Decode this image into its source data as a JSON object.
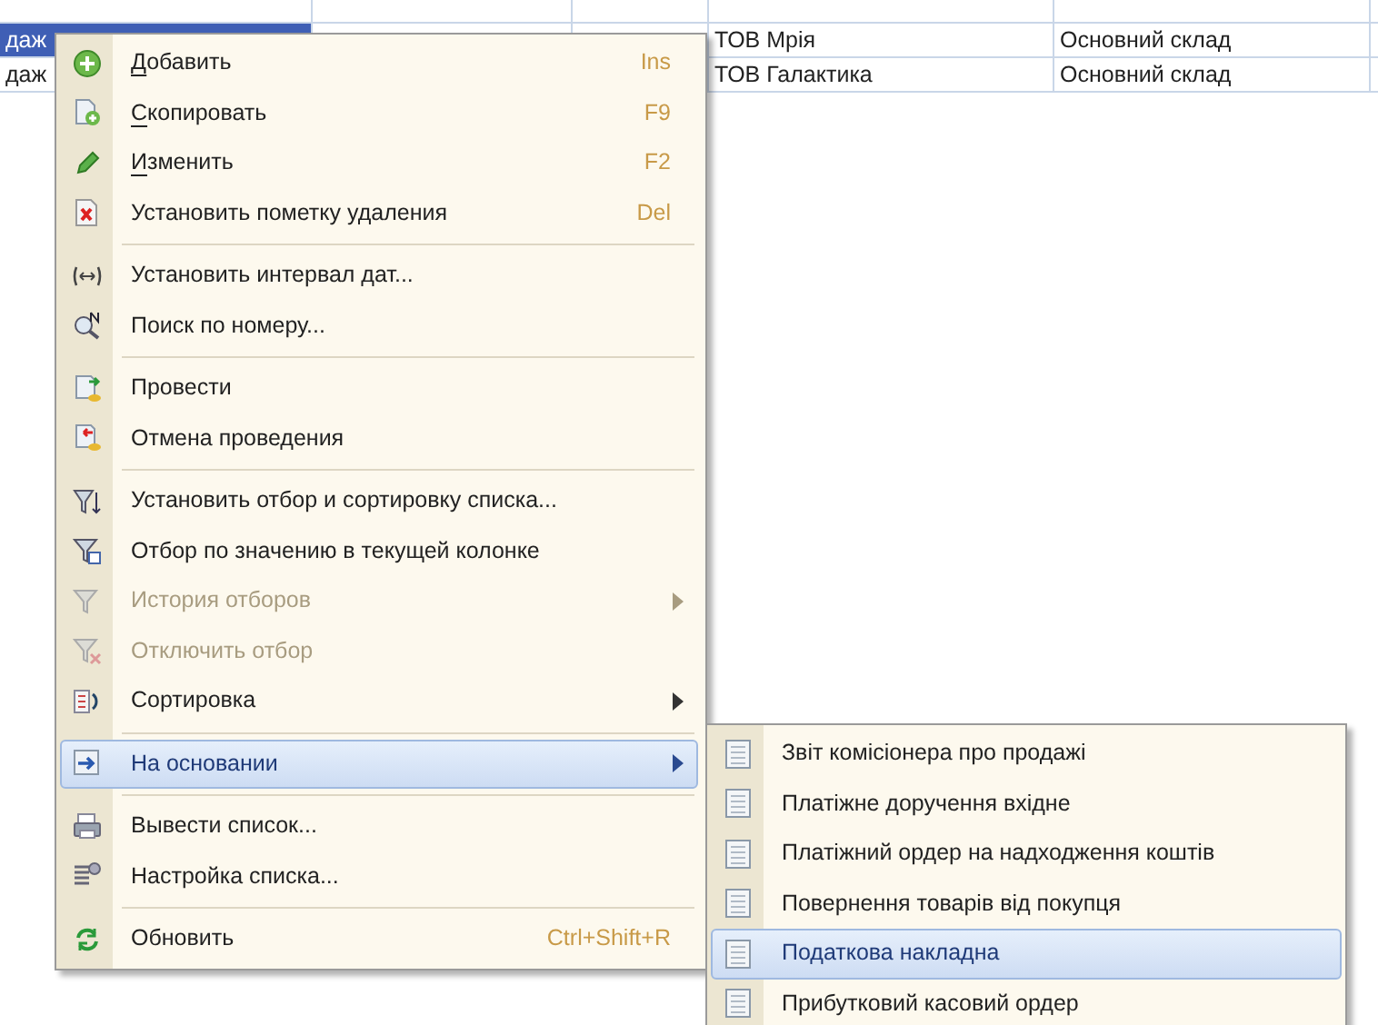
{
  "table": {
    "rows": [
      {
        "selected": true,
        "cells": [
          "даж",
          "ТОВ Мрія",
          "Основний склад"
        ]
      },
      {
        "selected": false,
        "cells": [
          "даж",
          "ТОВ Галактика",
          "Основний склад"
        ]
      }
    ]
  },
  "context_menu": {
    "items": [
      {
        "kind": "item",
        "label": "Добавить",
        "underline_first": true,
        "shortcut": "Ins",
        "disabled": false,
        "submenu": false,
        "selected": false
      },
      {
        "kind": "item",
        "label": "Скопировать",
        "underline_first": true,
        "shortcut": "F9",
        "disabled": false,
        "submenu": false,
        "selected": false
      },
      {
        "kind": "item",
        "label": "Изменить",
        "underline_first": true,
        "shortcut": "F2",
        "disabled": false,
        "submenu": false,
        "selected": false
      },
      {
        "kind": "item",
        "label": "Установить пометку удаления",
        "underline_first": false,
        "shortcut": "Del",
        "disabled": false,
        "submenu": false,
        "selected": false
      },
      {
        "kind": "separator"
      },
      {
        "kind": "item",
        "label": "Установить интервал дат...",
        "underline_first": false,
        "disabled": false,
        "submenu": false,
        "selected": false
      },
      {
        "kind": "item",
        "label": "Поиск по номеру...",
        "underline_first": false,
        "disabled": false,
        "submenu": false,
        "selected": false
      },
      {
        "kind": "separator"
      },
      {
        "kind": "item",
        "label": "Провести",
        "underline_first": false,
        "disabled": false,
        "submenu": false,
        "selected": false
      },
      {
        "kind": "item",
        "label": "Отмена проведения",
        "underline_first": false,
        "disabled": false,
        "submenu": false,
        "selected": false
      },
      {
        "kind": "separator"
      },
      {
        "kind": "item",
        "label": "Установить отбор и сортировку списка...",
        "underline_first": false,
        "disabled": false,
        "submenu": false,
        "selected": false
      },
      {
        "kind": "item",
        "label": "Отбор по значению в текущей колонке",
        "underline_first": false,
        "disabled": false,
        "submenu": false,
        "selected": false
      },
      {
        "kind": "item",
        "label": "История отборов",
        "underline_first": false,
        "disabled": true,
        "submenu": true,
        "selected": false
      },
      {
        "kind": "item",
        "label": "Отключить отбор",
        "underline_first": false,
        "disabled": true,
        "submenu": false,
        "selected": false
      },
      {
        "kind": "item",
        "label": "Сортировка",
        "underline_first": false,
        "disabled": false,
        "submenu": true,
        "selected": false
      },
      {
        "kind": "separator"
      },
      {
        "kind": "item",
        "label": "На основании",
        "underline_first": false,
        "disabled": false,
        "submenu": true,
        "selected": true
      },
      {
        "kind": "separator"
      },
      {
        "kind": "item",
        "label": "Вывести список...",
        "underline_first": false,
        "disabled": false,
        "submenu": false,
        "selected": false
      },
      {
        "kind": "item",
        "label": "Настройка списка...",
        "underline_first": false,
        "disabled": false,
        "submenu": false,
        "selected": false
      },
      {
        "kind": "separator"
      },
      {
        "kind": "item",
        "label": "Обновить",
        "underline_first": false,
        "shortcut": "Ctrl+Shift+R",
        "disabled": false,
        "submenu": false,
        "selected": false
      }
    ]
  },
  "submenu": {
    "items": [
      {
        "label": "Звіт комісіонера про продажі",
        "selected": false
      },
      {
        "label": "Платіжне доручення вхідне",
        "selected": false
      },
      {
        "label": "Платіжний ордер на надходження коштів",
        "selected": false
      },
      {
        "label": "Повернення товарів від покупця",
        "selected": false
      },
      {
        "label": "Податкова накладна",
        "selected": true
      },
      {
        "label": "Прибутковий касовий ордер",
        "selected": false
      }
    ]
  }
}
